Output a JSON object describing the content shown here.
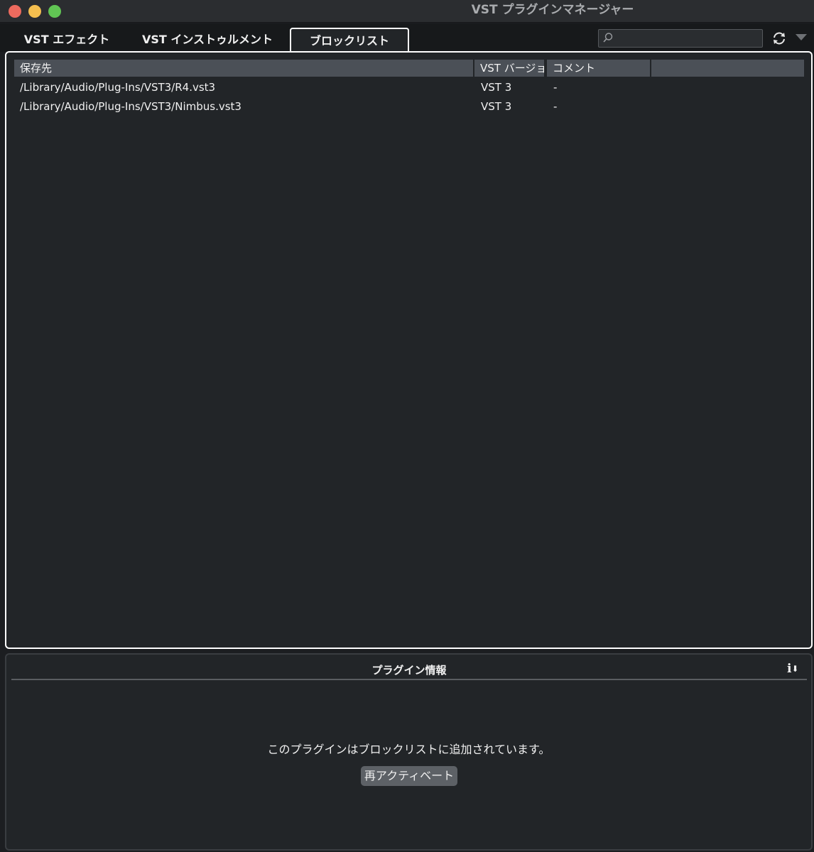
{
  "window": {
    "title": "VST プラグインマネージャー"
  },
  "tabs": {
    "effects": "VST エフェクト",
    "instruments": "VST インストゥルメント",
    "blocklist": "ブロックリスト"
  },
  "search": {
    "value": ""
  },
  "table": {
    "headers": {
      "path": "保存先",
      "version": "VST バージョン",
      "comment": "コメント",
      "extra": ""
    },
    "rows": [
      {
        "path": "/Library/Audio/Plug-Ins/VST3/R4.vst3",
        "version": "VST 3",
        "comment": "-"
      },
      {
        "path": "/Library/Audio/Plug-Ins/VST3/Nimbus.vst3",
        "version": "VST 3",
        "comment": "-"
      }
    ]
  },
  "info": {
    "title": "プラグイン情報",
    "message": "このプラグインはブロックリストに追加されています。",
    "reactivate_label": "再アクティベート"
  }
}
